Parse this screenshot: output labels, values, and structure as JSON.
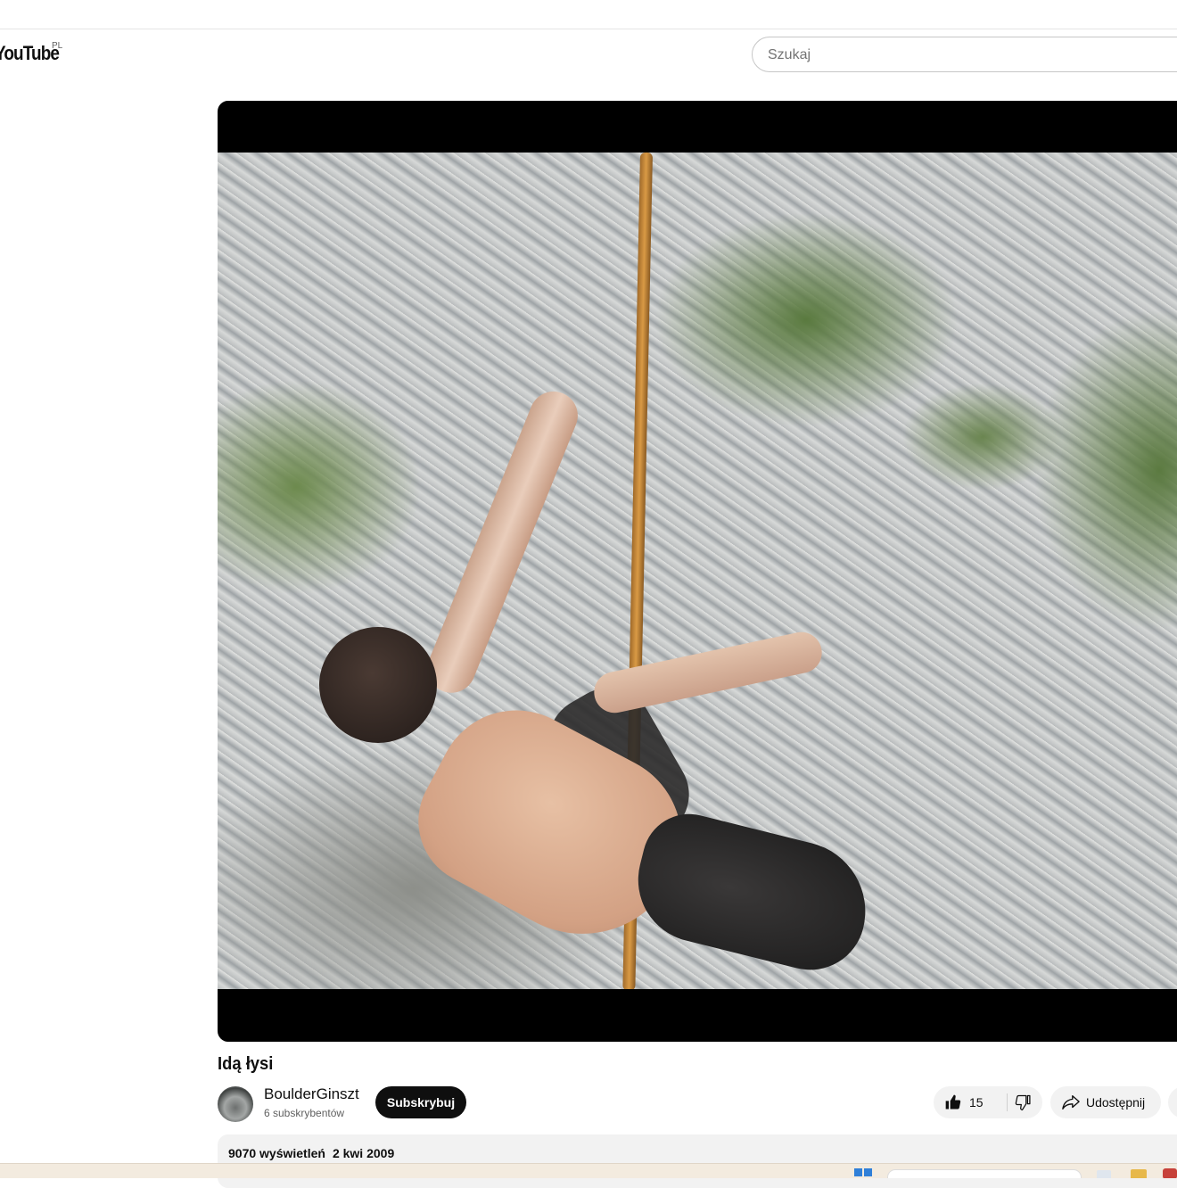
{
  "masthead": {
    "logo_text": "YouTube",
    "region": "PL",
    "search_placeholder": "Szukaj"
  },
  "video": {
    "title": "Idą łysi",
    "channel_name": "BoulderGinszt",
    "channel_subscribers": "6 subskrybentów",
    "subscribe_label": "Subskrybuj",
    "like_count": "15",
    "share_label": "Udostępnij",
    "views": "9070 wyświetleń",
    "date": "2 kwi 2009"
  },
  "icons": {
    "like": "thumbs-up-icon",
    "dislike": "thumbs-down-icon",
    "share": "share-arrow-icon"
  },
  "colors": {
    "subscribe_bg": "#0f0f0f",
    "pill_bg": "#f2f2f2",
    "player_bg": "#000000"
  }
}
